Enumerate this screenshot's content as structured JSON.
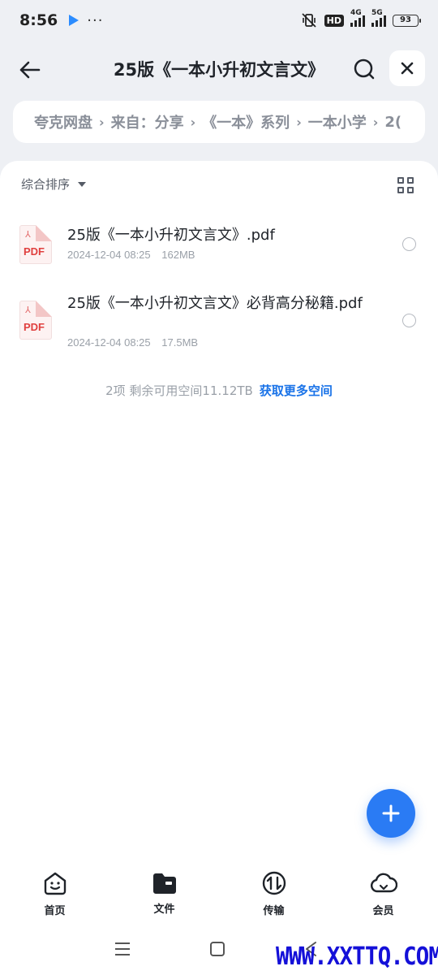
{
  "status_bar": {
    "time": "8:56",
    "dots": "···",
    "hd_label": "HD",
    "signal_1_label": "4G",
    "signal_2_label": "5G",
    "battery": "93"
  },
  "header": {
    "title": "25版《一本小升初文言文》",
    "back_icon": "arrow-left-icon",
    "search_icon": "search-icon",
    "close_icon": "close-icon"
  },
  "breadcrumb": {
    "items": [
      "夸克网盘",
      "来自：分享",
      "《一本》系列",
      "一本小学",
      "2("
    ]
  },
  "toolbar": {
    "sort_label": "综合排序",
    "view_toggle_icon": "grid-view-icon"
  },
  "files": [
    {
      "name": "25版《一本小升初文言文》.pdf",
      "date": "2024-12-04 08:25",
      "size": "162MB",
      "icon_text": "PDF"
    },
    {
      "name": "25版《一本小升初文言文》必背高分秘籍.pdf",
      "date": "2024-12-04 08:25",
      "size": "17.5MB",
      "icon_text": "PDF"
    }
  ],
  "footer": {
    "summary": "2项 剩余可用空间11.12TB",
    "link": "获取更多空间"
  },
  "bottom_nav": [
    {
      "label": "首页",
      "icon": "home-face-icon"
    },
    {
      "label": "文件",
      "icon": "folder-icon"
    },
    {
      "label": "传输",
      "icon": "transfer-icon"
    },
    {
      "label": "会员",
      "icon": "cloud-icon"
    }
  ],
  "watermark": "WWW.XXTTQ.COM",
  "colors": {
    "accent": "#2a7bf4",
    "link": "#1a73e8",
    "pdf_red": "#e0403f",
    "background": "#eef0f4"
  }
}
